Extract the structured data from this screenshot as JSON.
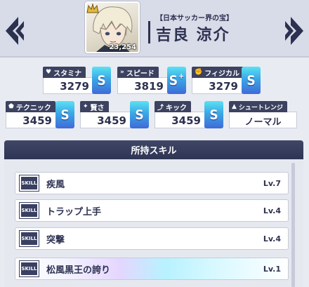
{
  "player": {
    "title": "【日本サッカー界の宝】",
    "name": "吉良 涼介",
    "value": "23,254"
  },
  "stats": {
    "stamina": {
      "label": "スタミナ",
      "icon": "heart-icon",
      "value": "3279",
      "rank": "S"
    },
    "speed": {
      "label": "スピード",
      "icon": "speed-icon",
      "value": "3819",
      "rank": "S",
      "rank_plus": "+"
    },
    "physical": {
      "label": "フィジカル",
      "icon": "fist-icon",
      "value": "3279",
      "rank": "S"
    },
    "technique": {
      "label": "テクニック",
      "icon": "pentagon-icon",
      "value": "3459",
      "rank": "S"
    },
    "wisdom": {
      "label": "賢さ",
      "icon": "sparkle-icon",
      "value": "3459",
      "rank": "S"
    },
    "kick": {
      "label": "キック",
      "icon": "boot-icon",
      "value": "3459",
      "rank": "S"
    },
    "shoot_range": {
      "label": "シュートレンジ",
      "icon": "triangle-icon",
      "value": "ノーマル"
    }
  },
  "skills": {
    "header": "所持スキル",
    "icon_label": "SKILL",
    "items": [
      {
        "name": "疾風",
        "level": "Lv.7"
      },
      {
        "name": "トラップ上手",
        "level": "Lv.4"
      },
      {
        "name": "突撃",
        "level": "Lv.4"
      },
      {
        "name": "松風黒王の誇り",
        "level": "Lv.1"
      }
    ]
  },
  "colors": {
    "rank_gradient_top": "#5be1f3",
    "rank_gradient_bottom": "#3f6ad8",
    "navy": "#2d3150",
    "label_bg": "#3c4260"
  }
}
